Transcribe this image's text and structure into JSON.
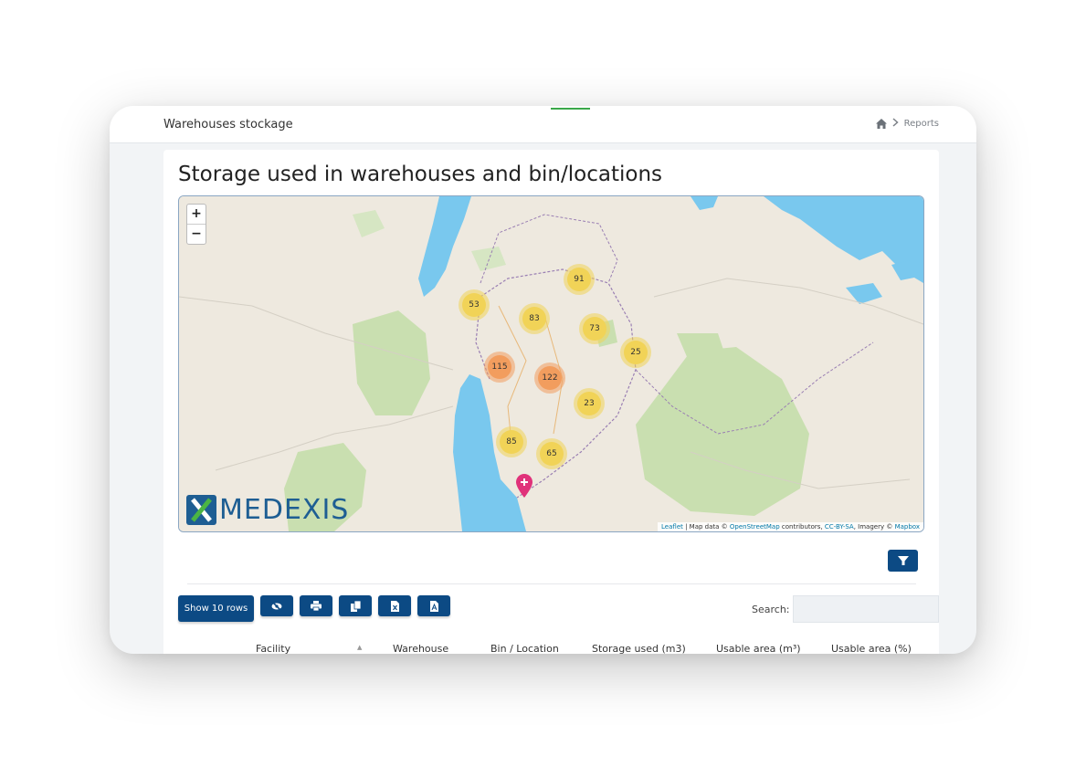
{
  "header": {
    "title": "Warehouses stockage",
    "breadcrumb": {
      "home_icon": "home-icon",
      "separator_icon": "chevron-right-icon",
      "current": "Reports"
    }
  },
  "card": {
    "title": "Storage used in warehouses and bin/locations"
  },
  "map": {
    "zoom_in": "+",
    "zoom_out": "−",
    "clusters": [
      {
        "id": "c91",
        "value": "91",
        "color": "yellow"
      },
      {
        "id": "c53",
        "value": "53",
        "color": "yellow"
      },
      {
        "id": "c83",
        "value": "83",
        "color": "yellow"
      },
      {
        "id": "c73",
        "value": "73",
        "color": "yellow"
      },
      {
        "id": "c25",
        "value": "25",
        "color": "yellow"
      },
      {
        "id": "c115",
        "value": "115",
        "color": "orange"
      },
      {
        "id": "c122",
        "value": "122",
        "color": "orange"
      },
      {
        "id": "c23",
        "value": "23",
        "color": "yellow"
      },
      {
        "id": "c85",
        "value": "85",
        "color": "yellow"
      },
      {
        "id": "c65",
        "value": "65",
        "color": "yellow"
      }
    ],
    "attribution": {
      "leaflet": "Leaflet",
      "text1": " | Map data © ",
      "osm": "OpenStreetMap",
      "text2": " contributors, ",
      "license": "CC-BY-SA",
      "text3": ", Imagery © ",
      "mapbox": "Mapbox"
    },
    "logo_text": "MEDEXIS",
    "colors": {
      "water": "#79c8ee",
      "land": "#eee9df",
      "park": "#c9dfb0",
      "border": "#9a7fb3"
    }
  },
  "toolbar": {
    "filter_icon": "filter-icon",
    "show_rows_label": "Show 10 rows",
    "icons": [
      "eye-slash-icon",
      "print-icon",
      "copy-icon",
      "excel-icon",
      "pdf-icon"
    ],
    "search_label": "Search:",
    "search_value": ""
  },
  "table": {
    "columns": [
      "Facility",
      "Warehouse",
      "Bin / Location",
      "Storage used (m3)",
      "Usable area (m³)",
      "Usable area (%)"
    ]
  },
  "colors": {
    "primary": "#0c4a84",
    "accent_green": "#3aa84a"
  }
}
